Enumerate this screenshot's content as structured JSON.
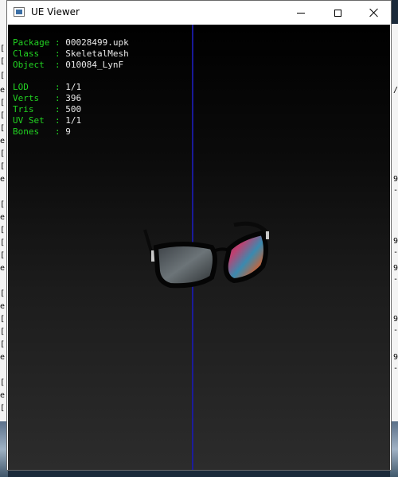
{
  "window": {
    "title": "UE Viewer"
  },
  "info_panel": {
    "rows": [
      {
        "label": "Package",
        "sep": ":",
        "value": "00028499.upk"
      },
      {
        "label": "Class  ",
        "sep": ":",
        "value": "SkeletalMesh"
      },
      {
        "label": "Object ",
        "sep": ":",
        "value": "010084_LynF"
      }
    ],
    "stats": [
      {
        "label": "LOD    ",
        "sep": ":",
        "value": "1/1"
      },
      {
        "label": "Verts  ",
        "sep": ":",
        "value": "396"
      },
      {
        "label": "Tris   ",
        "sep": ":",
        "value": "500"
      },
      {
        "label": "UV Set ",
        "sep": ":",
        "value": "1/1"
      },
      {
        "label": "Bones  ",
        "sep": ":",
        "value": "9"
      }
    ]
  },
  "colors": {
    "label": "#22d322",
    "value": "#e8e8e8",
    "axis": "#1b1ba8"
  },
  "icons": {
    "app_icon": "window-icon",
    "minimize": "minimize-icon",
    "maximize": "maximize-icon",
    "close": "close-icon"
  }
}
